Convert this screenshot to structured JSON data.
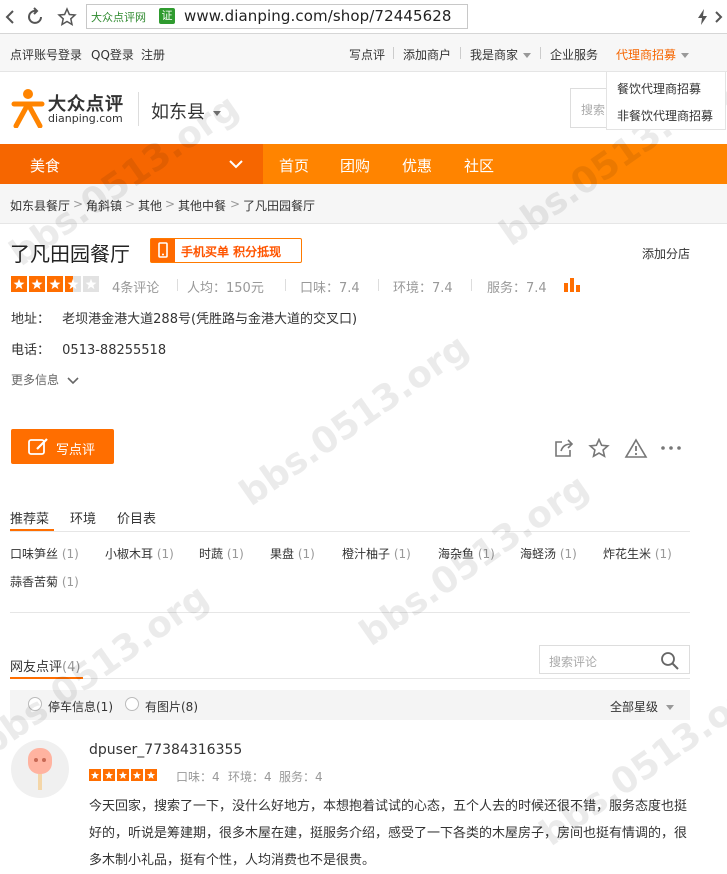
{
  "browser": {
    "site_chip": "大众点评网",
    "cert_label": "证",
    "url": "www.dianping.com/shop/72445628"
  },
  "topbar": {
    "login_dianping": "点评账号登录",
    "login_qq": "QQ登录",
    "register": "注册",
    "write_review": "写点评",
    "add_merchant": "添加商户",
    "i_am_merchant": "我是商家",
    "enterprise": "企业服务",
    "agent_recruit": "代理商招募",
    "agent_menu": [
      "餐饮代理商招募",
      "非餐饮代理商招募"
    ]
  },
  "header": {
    "logo_cn": "大众点评",
    "logo_en": "dianping.com",
    "city": "如东县",
    "search_placeholder": "搜索"
  },
  "nav": {
    "category": "美食",
    "items": [
      "首页",
      "团购",
      "优惠",
      "社区"
    ]
  },
  "breadcrumb": [
    "如东县餐厅",
    "角斜镇",
    "其他",
    "其他中餐",
    "了凡田园餐厅"
  ],
  "shop": {
    "name": "了凡田园餐厅",
    "mobile_badge": "手机买单 积分抵现",
    "add_branch": "添加分店",
    "rating_stars": 3.5,
    "review_count": "4条评论",
    "avg_price": "人均：150元",
    "taste": "口味：7.4",
    "environment": "环境：7.4",
    "service": "服务：7.4",
    "address_label": "地址：",
    "address": "老坝港金港大道288号(凭胜路与金港大道的交叉口)",
    "phone_label": "电话：",
    "phone": "0513-88255518",
    "more_info": "更多信息",
    "write_review_button": "写点评"
  },
  "dish_tabs": [
    "推荐菜",
    "环境",
    "价目表"
  ],
  "dishes": [
    {
      "name": "口味笋丝",
      "count": "(1)"
    },
    {
      "name": "小椒木耳",
      "count": "(1)"
    },
    {
      "name": "时蔬",
      "count": "(1)"
    },
    {
      "name": "果盘",
      "count": "(1)"
    },
    {
      "name": "橙汁柚子",
      "count": "(1)"
    },
    {
      "name": "海杂鱼",
      "count": "(1)"
    },
    {
      "name": "海蛏汤",
      "count": "(1)"
    },
    {
      "name": "炸花生米",
      "count": "(1)"
    },
    {
      "name": "蒜香苦菊",
      "count": "(1)"
    }
  ],
  "reviews": {
    "title": "网友点评",
    "count": "(4)",
    "search_placeholder": "搜索评论",
    "filter_parking": "停车信息(1)",
    "filter_photos": "有图片(8)",
    "filter_stars": "全部星级",
    "items": [
      {
        "user": "dpuser_77384316355",
        "stars": 5,
        "taste": "口味：4",
        "environment": "环境：4",
        "service": "服务：4",
        "text": "今天回家，搜索了一下，没什么好地方，本想抱着试试的心态，五个人去的时候还很不错，服务态度也挺好的，听说是筹建期，很多木屋在建，挺服务介绍，感受了一下各类的木屋房子，房间也挺有情调的，很多木制小礼品，挺有个性，人均消费也不是很贵。"
      }
    ]
  },
  "watermark": "bbs.0513.org",
  "colors": {
    "brand_orange": "#ff8400",
    "dark_orange": "#f66600",
    "star": "#ff6e00"
  }
}
